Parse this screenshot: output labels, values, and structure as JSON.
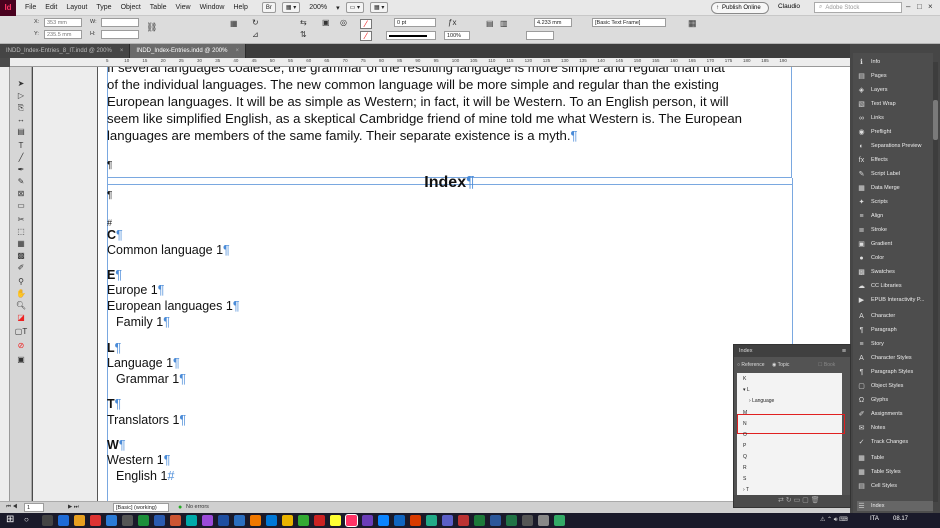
{
  "menubar": {
    "logo": "Id",
    "items": [
      "File",
      "Edit",
      "Layout",
      "Type",
      "Object",
      "Table",
      "View",
      "Window",
      "Help"
    ],
    "br": "Br",
    "zoom": "200%",
    "publish": "Publish Online",
    "user": "Claudio",
    "stock_placeholder": "Adobe Stock"
  },
  "control": {
    "x_val": "353 mm",
    "y_val": "235.5 mm",
    "stroke_pt": "0 pt",
    "opacity": "100%",
    "dim": "4.233 mm",
    "frame_style": "[Basic Text Frame]"
  },
  "tabs": [
    {
      "label": "INDD_Index-Entries_8_IT.indd @ 200%",
      "close": "×"
    },
    {
      "label": "INDD_Index-Entries.indd @ 200%",
      "close": "×"
    }
  ],
  "ruler_labels": [
    "5",
    "10",
    "15",
    "20",
    "25",
    "30",
    "35",
    "40",
    "45",
    "50",
    "55",
    "60",
    "65",
    "70",
    "75",
    "80",
    "85",
    "90",
    "95",
    "100",
    "105",
    "110",
    "115",
    "120",
    "125",
    "130",
    "135",
    "140",
    "145",
    "150",
    "155",
    "160",
    "165",
    "170",
    "175",
    "180",
    "185",
    "190"
  ],
  "doc": {
    "body_lines": [
      "If several languages coalesce, the grammar of the resulting language is more simple and regular than that",
      "of the individual languages. The new common language will be more simple and regular than the existing",
      "European languages. It will be as simple as Western; in fact, it will be Western. To an English person, it will",
      "seem like simplified English, as a skeptical Cambridge friend of mine told me what Western is. The European",
      "languages are members of the same family. Their separate existence is a myth."
    ],
    "pilcrow": "¶",
    "index_title": "Index",
    "hash": "#",
    "sections": [
      {
        "letter": "C",
        "entries": [
          {
            "text": "Common language  1"
          }
        ]
      },
      {
        "letter": "E",
        "entries": [
          {
            "text": "Europe  1"
          },
          {
            "text": "European languages  1"
          },
          {
            "text": "Family  1",
            "sub": true
          }
        ]
      },
      {
        "letter": "L",
        "entries": [
          {
            "text": "Language  1"
          },
          {
            "text": "Grammar  1",
            "sub": true
          }
        ]
      },
      {
        "letter": "T",
        "entries": [
          {
            "text": "Translators  1"
          }
        ]
      },
      {
        "letter": "W",
        "entries": [
          {
            "text": "Western  1"
          },
          {
            "text": "English  1",
            "sub": true,
            "end": "#"
          }
        ]
      }
    ]
  },
  "status": {
    "page": "1",
    "style": "[Basic] (working)",
    "errors": "No errors"
  },
  "dock_items": [
    {
      "icon": "info-icon",
      "glyph": "ℹ",
      "label": "Info"
    },
    {
      "icon": "pages-icon",
      "glyph": "▤",
      "label": "Pages"
    },
    {
      "icon": "layers-icon",
      "glyph": "◈",
      "label": "Layers"
    },
    {
      "icon": "text-wrap-icon",
      "glyph": "▧",
      "label": "Text Wrap"
    },
    {
      "icon": "links-icon",
      "glyph": "∞",
      "label": "Links"
    },
    {
      "icon": "preflight-icon",
      "glyph": "◉",
      "label": "Preflight"
    },
    {
      "icon": "separations-icon",
      "glyph": "◐",
      "label": "Separations Preview"
    },
    {
      "icon": "effects-icon",
      "glyph": "fx",
      "label": "Effects"
    },
    {
      "icon": "script-label-icon",
      "glyph": "✎",
      "label": "Script Label"
    },
    {
      "icon": "data-merge-icon",
      "glyph": "▦",
      "label": "Data Merge"
    },
    {
      "icon": "scripts-icon",
      "glyph": "✦",
      "label": "Scripts"
    },
    {
      "icon": "align-icon",
      "glyph": "≡",
      "label": "Align"
    },
    {
      "icon": "stroke-icon",
      "glyph": "≣",
      "label": "Stroke"
    },
    {
      "icon": "gradient-icon",
      "glyph": "▣",
      "label": "Gradient"
    },
    {
      "icon": "color-icon",
      "glyph": "●",
      "label": "Color"
    },
    {
      "icon": "swatches-icon",
      "glyph": "▩",
      "label": "Swatches"
    },
    {
      "icon": "cc-libraries-icon",
      "glyph": "☁",
      "label": "CC Libraries"
    },
    {
      "icon": "epub-icon",
      "glyph": "▶",
      "label": "EPUB Interactivity P..."
    },
    {
      "icon": "character-icon",
      "glyph": "A",
      "label": "Character"
    },
    {
      "icon": "paragraph-icon",
      "glyph": "¶",
      "label": "Paragraph"
    },
    {
      "icon": "story-icon",
      "glyph": "≡",
      "label": "Story"
    },
    {
      "icon": "character-styles-icon",
      "glyph": "A",
      "label": "Character Styles"
    },
    {
      "icon": "paragraph-styles-icon",
      "glyph": "¶",
      "label": "Paragraph Styles"
    },
    {
      "icon": "object-styles-icon",
      "glyph": "▢",
      "label": "Object Styles"
    },
    {
      "icon": "glyphs-icon",
      "glyph": "Ω",
      "label": "Glyphs"
    },
    {
      "icon": "assignments-icon",
      "glyph": "✐",
      "label": "Assignments"
    },
    {
      "icon": "notes-icon",
      "glyph": "✉",
      "label": "Notes"
    },
    {
      "icon": "track-changes-icon",
      "glyph": "✓",
      "label": "Track Changes"
    },
    {
      "icon": "table-icon",
      "glyph": "▦",
      "label": "Table"
    },
    {
      "icon": "table-styles-icon",
      "glyph": "▦",
      "label": "Table Styles"
    },
    {
      "icon": "cell-styles-icon",
      "glyph": "▤",
      "label": "Cell Styles"
    },
    {
      "icon": "index-icon",
      "glyph": "☰",
      "label": "Index"
    }
  ],
  "index_panel": {
    "title": "Index",
    "reference": "Reference",
    "topic": "Topic",
    "book": "Book",
    "letters": [
      "K",
      "L",
      "M",
      "N",
      "O",
      "P",
      "Q",
      "R",
      "S",
      "T"
    ],
    "expanded": "L",
    "topic_item": "Language"
  },
  "taskbar": {
    "time": "08.17",
    "lang": "ITA"
  }
}
